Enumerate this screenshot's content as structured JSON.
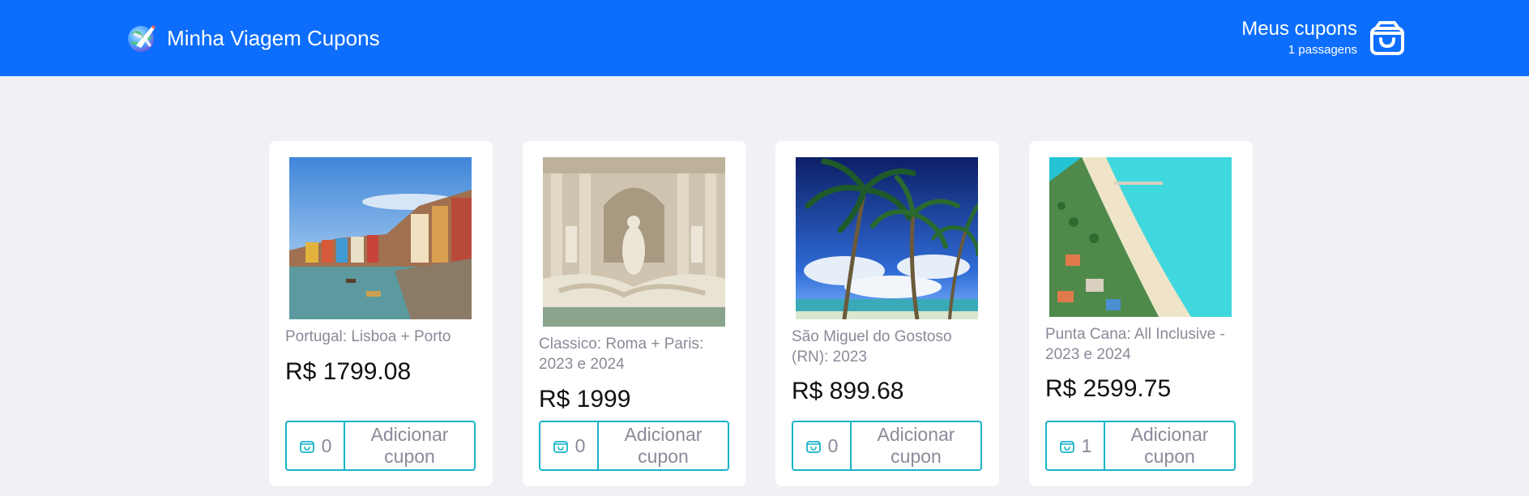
{
  "header": {
    "brand_title": "Minha Viagem Cupons",
    "logo_icon": "globe-plane-icon",
    "cart_title": "Meus cupons",
    "cart_count": "1 passagens",
    "cart_icon": "shopping-bag-icon",
    "background_color": "#0d6efd"
  },
  "products": [
    {
      "name": "Portugal: Lisboa + Porto",
      "price": "R$ 1799.08",
      "qty": "0",
      "button_label": "Adicionar cupon",
      "image_subject": "porto-riverside-photo"
    },
    {
      "name": "Classico: Roma + Paris: 2023 e 2024",
      "price": "R$ 1999",
      "qty": "0",
      "button_label": "Adicionar cupon",
      "image_subject": "trevi-fountain-photo"
    },
    {
      "name": "São Miguel do Gostoso (RN): 2023",
      "price": "R$ 899.68",
      "qty": "0",
      "button_label": "Adicionar cupon",
      "image_subject": "palm-trees-photo"
    },
    {
      "name": "Punta Cana: All Inclusive - 2023 e 2024",
      "price": "R$ 2599.75",
      "qty": "1",
      "button_label": "Adicionar cupon",
      "image_subject": "aerial-beach-photo"
    }
  ],
  "colors": {
    "accent_border": "#19b4c9",
    "muted_text": "#8a8a99",
    "page_background": "#f0f0f5"
  }
}
